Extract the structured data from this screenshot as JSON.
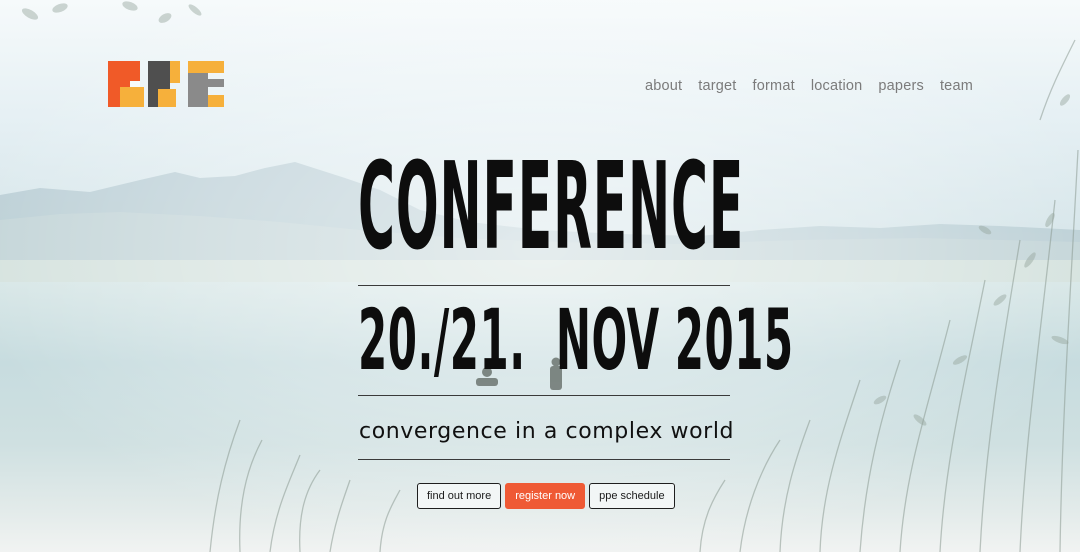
{
  "logo": {
    "text": "PPE",
    "colors": [
      "#f05a28",
      "#f6b03b",
      "#555555",
      "#8a8a8a"
    ]
  },
  "nav": {
    "items": [
      "about",
      "target",
      "format",
      "location",
      "papers",
      "team"
    ]
  },
  "hero": {
    "title": "CONFERENCE",
    "date": "20./21.  NOV 2015",
    "subtitle": "convergence in a complex world"
  },
  "buttons": {
    "find_out_more": "find out more",
    "register_now": "register now",
    "ppe_schedule": "ppe schedule"
  },
  "colors": {
    "accent": "#ef5a35",
    "text": "#0d0d0d",
    "nav": "#7b7b7b"
  }
}
